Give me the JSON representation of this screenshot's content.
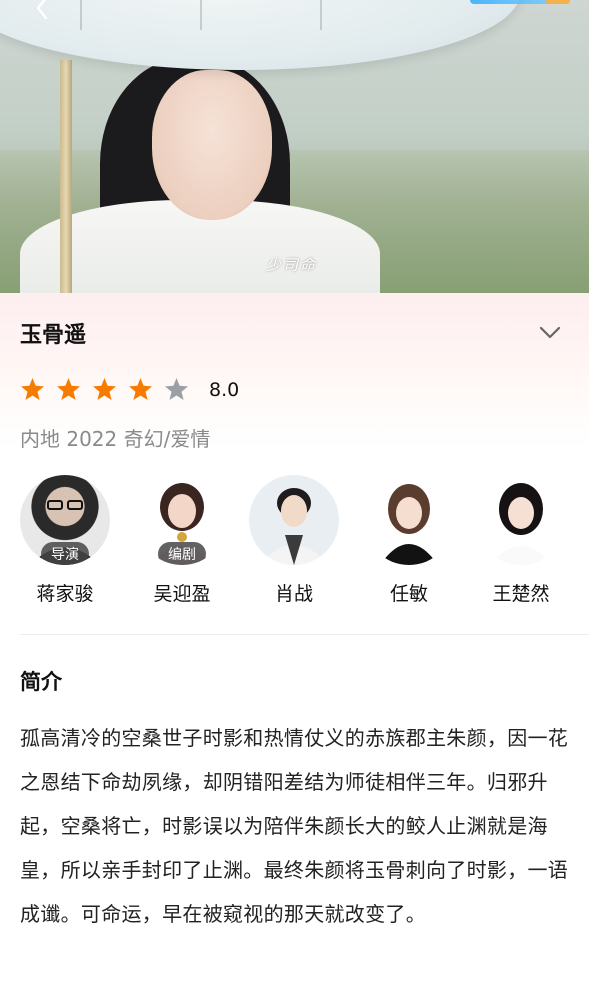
{
  "hero": {
    "caption": "少司命"
  },
  "show": {
    "title": "玉骨遥",
    "rating": {
      "score": "8.0",
      "stars_filled": 4,
      "stars_total": 5,
      "star_color": "#f57c00",
      "star_empty_color": "#9aa0a6"
    },
    "meta": "内地 2022 奇幻/爱情"
  },
  "cast": [
    {
      "name": "蒋家骏",
      "role": "导演"
    },
    {
      "name": "吴迎盈",
      "role": "编剧"
    },
    {
      "name": "肖战",
      "role": ""
    },
    {
      "name": "任敏",
      "role": ""
    },
    {
      "name": "王楚然",
      "role": ""
    }
  ],
  "intro": {
    "heading": "简介",
    "text": "孤高清冷的空桑世子时影和热情仗义的赤族郡主朱颜，因一花之恩结下命劫夙缘，却阴错阳差结为师徒相伴三年。归邪升起，空桑将亡，时影误以为陪伴朱颜长大的鲛人止渊就是海皇，所以亲手封印了止渊。最终朱颜将玉骨刺向了时影，一语成谶。可命运，早在被窥视的那天就改变了。"
  },
  "icons": {
    "back": "chevron-left-icon",
    "expand": "chevron-down-icon",
    "star": "star-icon"
  }
}
